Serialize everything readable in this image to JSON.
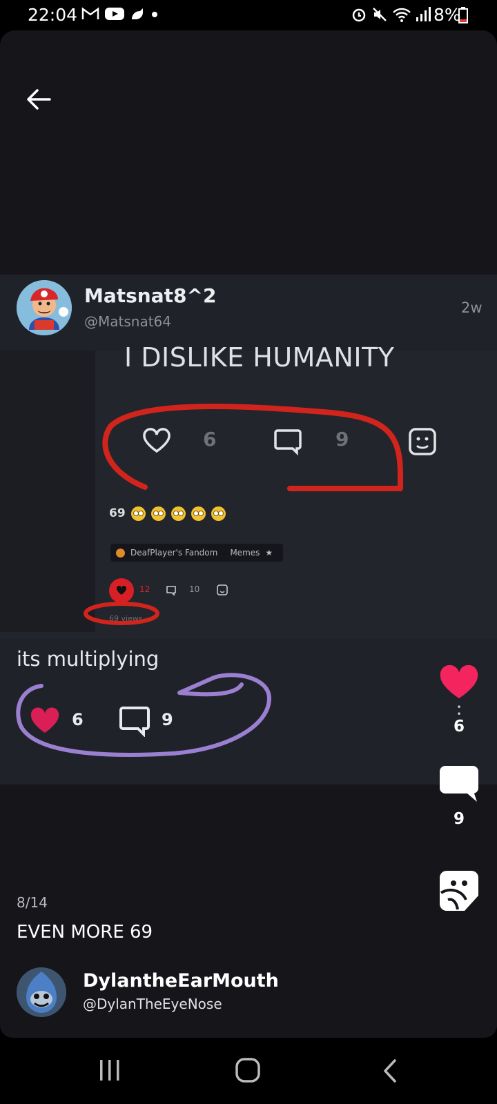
{
  "status_bar": {
    "time": "22:04",
    "battery": "8%"
  },
  "post": {
    "author_name": "Matsnat8^2",
    "author_handle": "@Matsnat64",
    "age": "2w",
    "caption": "its multiplying",
    "likes": "6",
    "comments": "9",
    "embedded": {
      "title": "I DISLIKE HUMANITY",
      "likes": "6",
      "comments": "9",
      "text_69": "69",
      "fandom_name": "DeafPlayer's Fandom",
      "category": "Memes",
      "mini_likes": "12",
      "mini_comments": "10",
      "views": "69 views"
    }
  },
  "side_actions": {
    "likes": "6",
    "comments": "9"
  },
  "album": {
    "page": "8/14",
    "title": "EVEN MORE 69"
  },
  "poster": {
    "name": "DylantheEarMouth",
    "handle": "@DylanTheEyeNose"
  },
  "colors": {
    "accent_heart": "#f4245e",
    "red_scribble": "#d1241c",
    "purple_scribble": "#9b7fd0",
    "background": "#15151a",
    "card": "#20222a"
  }
}
